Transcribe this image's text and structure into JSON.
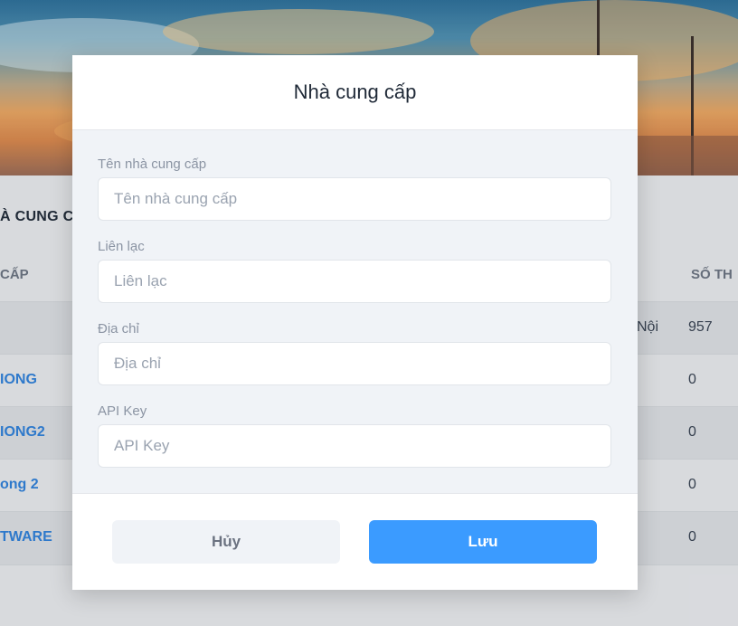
{
  "background_page": {
    "section_title": "À CUNG C",
    "table": {
      "headers": [
        "CẤP",
        "SỐ TH"
      ],
      "rows": [
        {
          "name": "",
          "address": "Nội",
          "count": "957"
        },
        {
          "name": "IONG",
          "address": "",
          "count": "0"
        },
        {
          "name": "IONG2",
          "address": "",
          "count": "0"
        },
        {
          "name": "ong 2",
          "address": "",
          "count": "0"
        },
        {
          "name": "TWARE",
          "address": "",
          "count": "0"
        }
      ]
    }
  },
  "modal": {
    "title": "Nhà cung cấp",
    "fields": [
      {
        "label": "Tên nhà cung cấp",
        "placeholder": "Tên nhà cung cấp",
        "value": ""
      },
      {
        "label": "Liên lạc",
        "placeholder": "Liên lạc",
        "value": ""
      },
      {
        "label": "Địa chỉ",
        "placeholder": "Địa chỉ",
        "value": ""
      },
      {
        "label": "API Key",
        "placeholder": "API Key",
        "value": ""
      }
    ],
    "cancel_label": "Hủy",
    "save_label": "Lưu"
  },
  "colors": {
    "primary": "#3b9bff",
    "link": "#2f7fd8"
  }
}
